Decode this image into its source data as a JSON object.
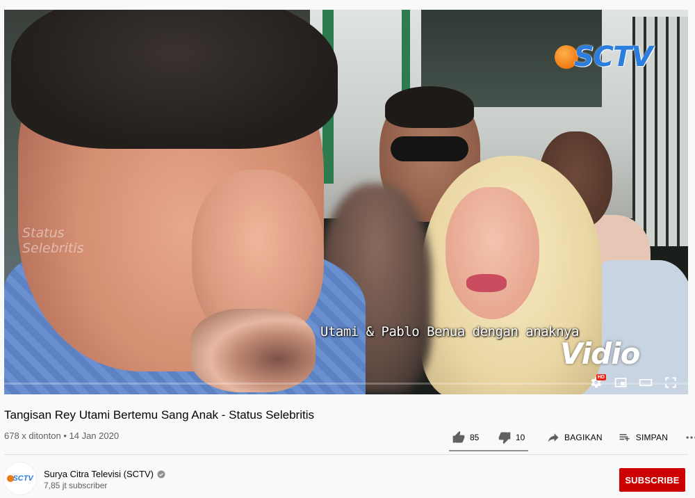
{
  "player": {
    "caption": "Utami & Pablo Benua dengan anaknya",
    "channel_logo": "SCTV",
    "watermark_line1": "Status",
    "watermark_line2": "Selebritis",
    "partner_logo": "Vidio",
    "hd_badge": "HD",
    "controls": [
      "settings-icon",
      "miniplayer-icon",
      "theater-mode-icon",
      "fullscreen-icon"
    ],
    "progress": 0.0
  },
  "video": {
    "title": "Tangisan Rey Utami Bertemu Sang Anak - Status Selebritis",
    "views": "678 x ditonton",
    "separator": "•",
    "date": "14 Jan 2020"
  },
  "actions": {
    "like_count": "85",
    "dislike_count": "10",
    "share_label": "BAGIKAN",
    "save_label": "SIMPAN",
    "like_ratio": 0.895
  },
  "channel": {
    "name": "Surya Citra Televisi (SCTV)",
    "subscribers": "7,85 jt subscriber",
    "avatar_text": "SCTV",
    "subscribe_label": "SUBSCRIBE"
  },
  "colors": {
    "subscribe": "#cc0000",
    "sctv_blue": "#2c7de0",
    "sctv_orange": "#f07a12",
    "secondary_text": "#606060"
  }
}
